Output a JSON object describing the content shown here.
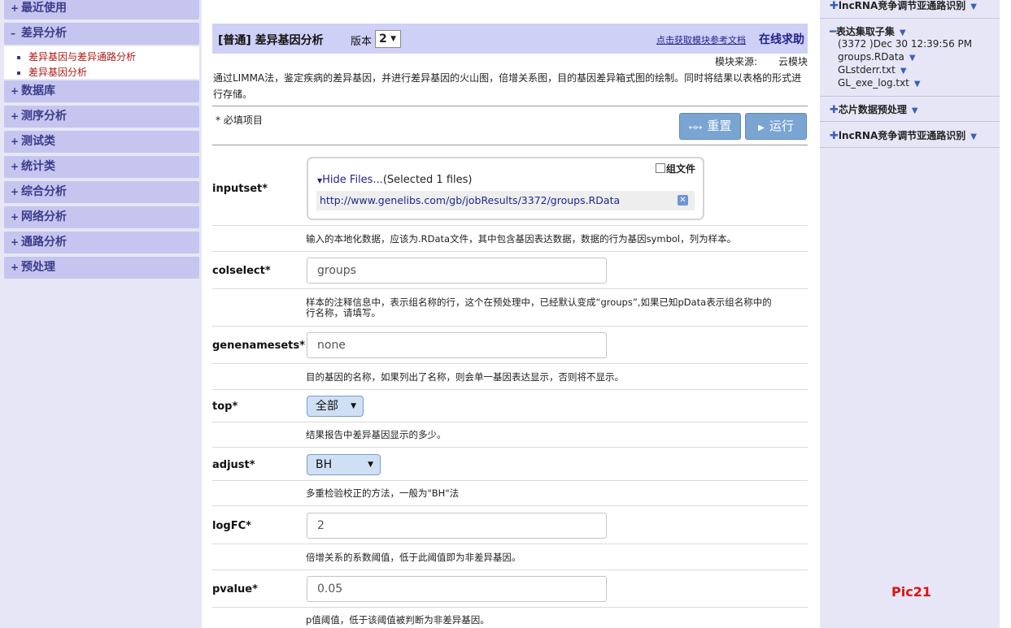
{
  "sidebar": {
    "categories": [
      {
        "label": "最近使用",
        "symbol": "+"
      },
      {
        "label": "差异分析",
        "symbol": "–"
      },
      {
        "label": "数据库",
        "symbol": "+"
      },
      {
        "label": "测序分析",
        "symbol": "+"
      },
      {
        "label": "测试类",
        "symbol": "+"
      },
      {
        "label": "统计类",
        "symbol": "+"
      },
      {
        "label": "综合分析",
        "symbol": "+"
      },
      {
        "label": "网络分析",
        "symbol": "+"
      },
      {
        "label": "通路分析",
        "symbol": "+"
      },
      {
        "label": "预处理",
        "symbol": "+"
      }
    ],
    "subitems": [
      "差异基因与差异通路分析",
      "差异基因分析"
    ]
  },
  "module": {
    "title": "[普通] 差异基因分析",
    "version_label": "版本",
    "version_value": "2",
    "help_link": "点击获取模块参考文档",
    "help_online": "在线求助",
    "source_label": "模块来源:",
    "source_value": "云模块",
    "description": "通过LIMMA法，鉴定疾病的差异基因，并进行差异基因的火山图，倍增关系图，目的基因差异箱式图的绘制。同时将结果以表格的形式进行存储。",
    "required_note": "* 必填项目",
    "reset_label": "重置",
    "run_label": "运行"
  },
  "params": {
    "inputset": {
      "label": "inputset*",
      "group_file": "组文件",
      "hide_files": "Hide Files...",
      "selected": "(Selected 1 files)",
      "file_url": "http://www.genelibs.com/gb/jobResults/3372/groups.RData",
      "hint": "输入的本地化数据，应该为.RData文件，其中包含基因表达数据，数据的行为基因symbol，列为样本。"
    },
    "colselect": {
      "label": "colselect*",
      "value": "groups",
      "hint_line1": "样本的注释信息中，表示组名称的行，这个在预处理中，已经默认变成“groups”,如果已知pData表示组名称中的",
      "hint_line2": "行名称，请填写。"
    },
    "genenamesets": {
      "label": "genenamesets*",
      "value": "none",
      "hint": "目的基因的名称，如果列出了名称，则会单一基因表达显示，否则将不显示。"
    },
    "top": {
      "label": "top*",
      "value": "全部",
      "hint": "结果报告中差异基因显示的多少。"
    },
    "adjust": {
      "label": "adjust*",
      "value": "BH",
      "hint": "多重检验校正的方法，一般为\"BH\"法"
    },
    "logFC": {
      "label": "logFC*",
      "value": "2",
      "hint": "倍增关系的系数阈值，低于此阈值即为非差异基因。"
    },
    "pvalue": {
      "label": "pvalue*",
      "value": "0.05",
      "hint": "p值阈值，低于该阈值被判断为非差异基因。"
    }
  },
  "right_panel": {
    "sec_lnc_top": "lncRNA竞争调节亚通路识别",
    "sec_expr": "表达集取子集",
    "expr_items": [
      "(3372 )Dec 30 12:39:56 PM",
      "groups.RData",
      "GLstderr.txt",
      "GL_exe_log.txt"
    ],
    "sec_chip": "芯片数据预处理",
    "sec_lnc": "lncRNA竞争调节亚通路识别",
    "pic_label": "Pic21"
  },
  "colors": {
    "sidebar_bg": "#e6e6f6",
    "category_bg": "#c5c5ef",
    "header_bg": "#cfd0f6",
    "button_bg": "#7aa5d3",
    "link": "#23238c",
    "subitem_red": "#b01818",
    "pic_label_red": "#e01010"
  },
  "icons": {
    "expand": "plus-icon",
    "collapse": "minus-icon",
    "dropdown": "caret-down-icon",
    "reset": "reset-icon",
    "run": "play-icon",
    "remove": "close-icon"
  }
}
